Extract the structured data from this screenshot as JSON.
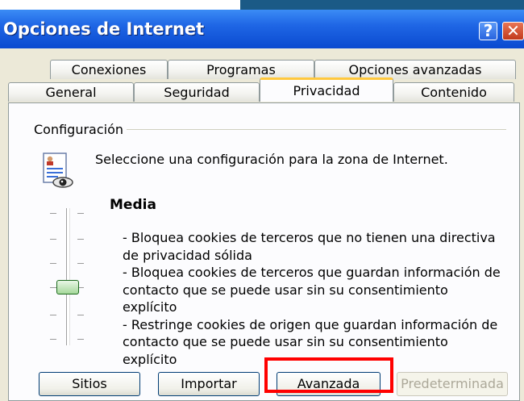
{
  "window": {
    "title": "Opciones de Internet",
    "help_glyph": "?",
    "close_glyph": "✕"
  },
  "tabs_back": [
    {
      "label": "Conexiones"
    },
    {
      "label": "Programas"
    },
    {
      "label": "Opciones avanzadas"
    }
  ],
  "tabs_front": [
    {
      "label": "General"
    },
    {
      "label": "Seguridad"
    },
    {
      "label": "Privacidad",
      "active": true
    },
    {
      "label": "Contenido"
    }
  ],
  "settings": {
    "group_label": "Configuración",
    "intro_text": "Seleccione una configuración para la zona de Internet.",
    "level_title": "Media",
    "level_position": "Media (3 de 6)",
    "description": "- Bloquea cookies de terceros que no tienen una directiva\nde privacidad sólida\n- Bloquea cookies de terceros que guardan información de\ncontacto que se puede usar sin su consentimiento explícito\n- Restringe cookies de origen que guardan información de\ncontacto que se  puede usar sin su consentimiento explícito"
  },
  "buttons": {
    "sites": "Sitios",
    "import": "Importar",
    "advanced": "Avanzada",
    "default": "Predeterminada"
  },
  "colors": {
    "titlebar": "#1f66e5",
    "active_tab_accent": "#ffc83c",
    "highlight": "#ff0000",
    "slider_thumb": "#a5d89b"
  }
}
